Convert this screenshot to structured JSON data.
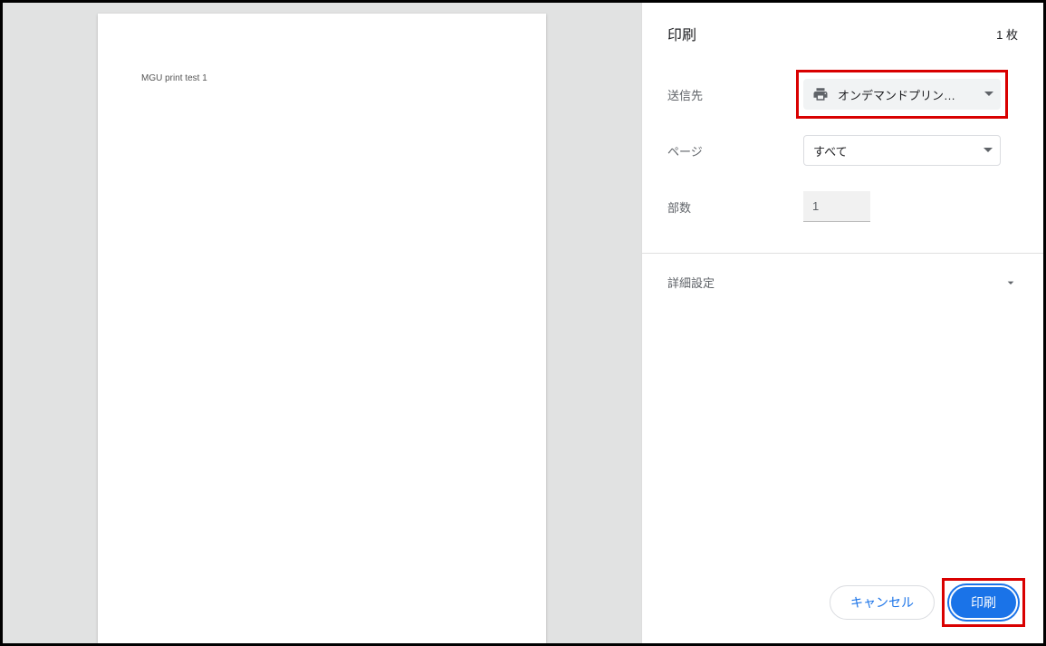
{
  "preview": {
    "content_text": "MGU print test 1"
  },
  "panel": {
    "title": "印刷",
    "sheet_count": "1 枚"
  },
  "settings": {
    "destination": {
      "label": "送信先",
      "value": "オンデマンドプリン…"
    },
    "pages": {
      "label": "ページ",
      "value": "すべて"
    },
    "copies": {
      "label": "部数",
      "value": "1"
    }
  },
  "more_settings": {
    "label": "詳細設定"
  },
  "footer": {
    "cancel": "キャンセル",
    "print": "印刷"
  }
}
